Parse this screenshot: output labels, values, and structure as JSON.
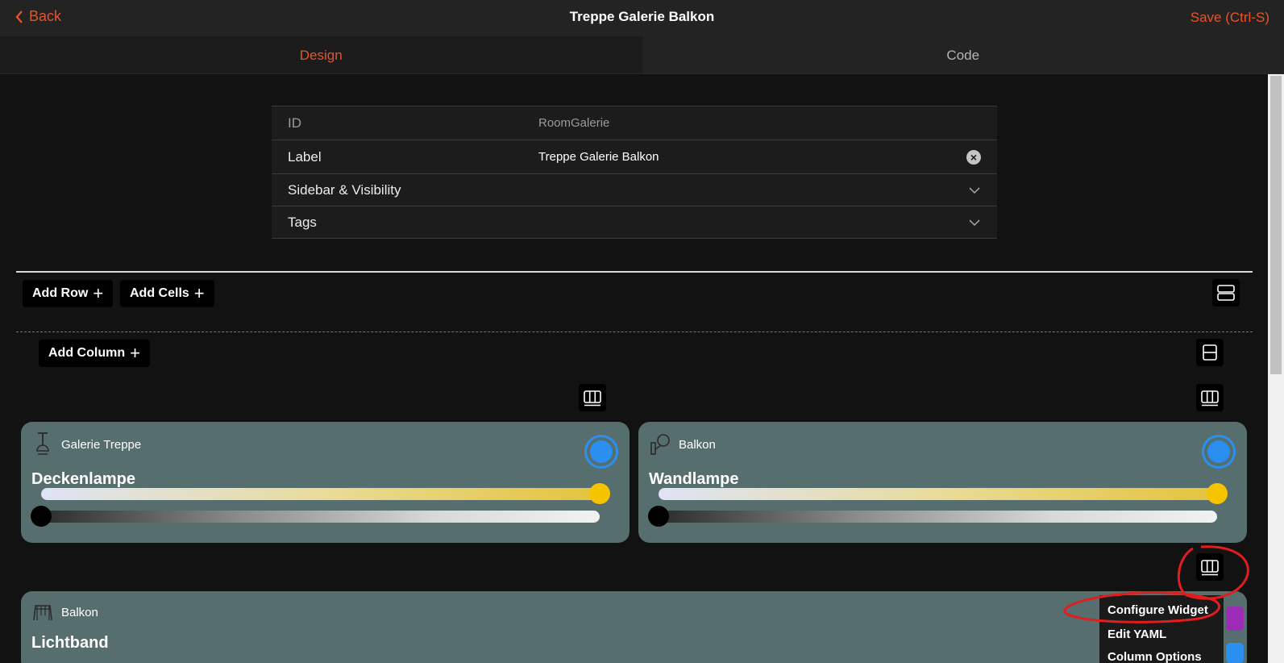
{
  "header": {
    "back_label": "Back",
    "title": "Treppe Galerie Balkon",
    "save_label": "Save (Ctrl-S)"
  },
  "tabs": [
    {
      "label": "Design",
      "active": true
    },
    {
      "label": "Code",
      "active": false
    }
  ],
  "properties": {
    "id": {
      "label": "ID",
      "value": "RoomGalerie"
    },
    "label": {
      "label": "Label",
      "value": "Treppe Galerie Balkon"
    },
    "sidebar": {
      "label": "Sidebar & Visibility"
    },
    "tags": {
      "label": "Tags"
    }
  },
  "toolbar": {
    "add_row": "Add Row",
    "add_cells": "Add Cells",
    "add_column": "Add Column"
  },
  "widgets": [
    {
      "room": "Galerie Treppe",
      "name": "Deckenlampe",
      "icon": "ceiling-lamp-icon",
      "color_temp": 1.0,
      "brightness": 0.0
    },
    {
      "room": "Balkon",
      "name": "Wandlampe",
      "icon": "wall-lamp-icon",
      "color_temp": 1.0,
      "brightness": 0.0
    },
    {
      "room": "Balkon",
      "name": "Lichtband",
      "icon": "light-strip-icon"
    }
  ],
  "context_menu": {
    "items": [
      "Configure Widget",
      "Edit YAML",
      "Column Options"
    ]
  },
  "colors": {
    "accent": "#e8542a",
    "card_bg": "#566e6e",
    "power_blue": "#2b8ff0",
    "knob_yellow": "#f6c300",
    "annotation_red": "#e11d1d"
  }
}
